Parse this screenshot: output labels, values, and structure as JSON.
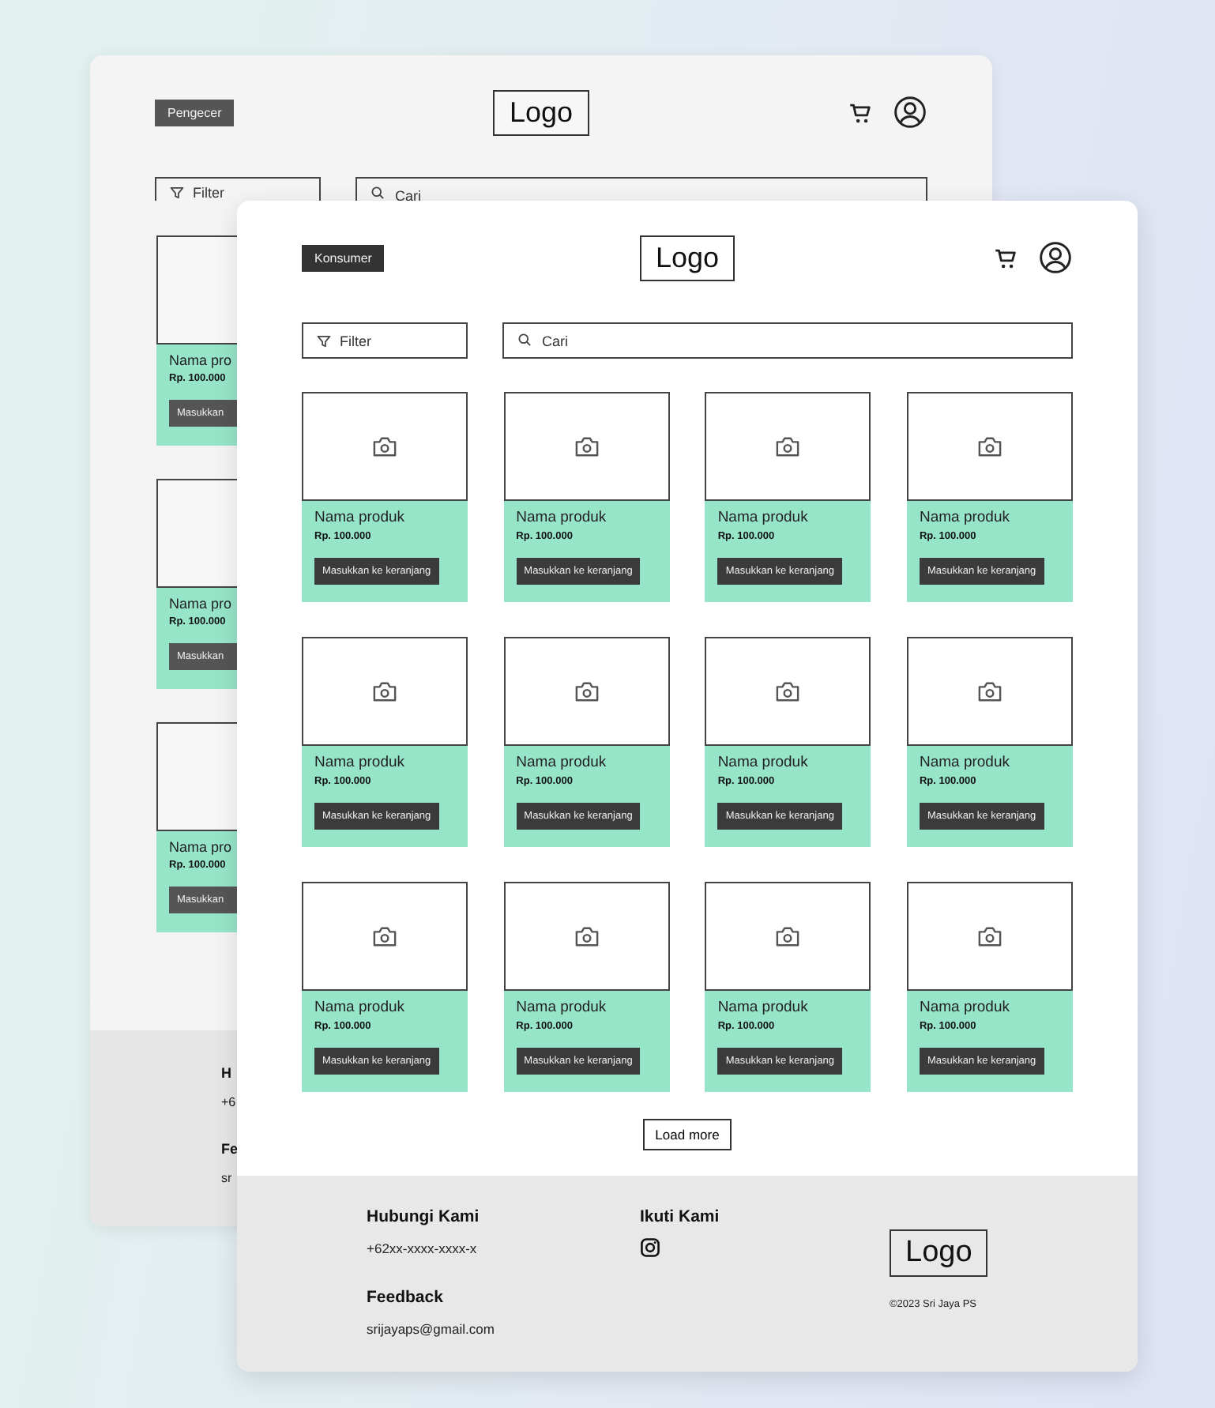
{
  "back_page": {
    "role_badge": "Pengecer",
    "logo": "Logo",
    "filter": {
      "label": "Filter"
    },
    "search": {
      "placeholder": "Cari"
    },
    "products": [
      {
        "name": "Nama pro",
        "price": "Rp. 100.000",
        "button": "Masukkan"
      },
      {
        "name": "Nama pro",
        "price": "Rp. 100.000",
        "button": "Masukkan"
      },
      {
        "name": "Nama pro",
        "price": "Rp. 100.000",
        "button": "Masukkan"
      }
    ],
    "footer": {
      "contact_heading": "H",
      "phone": "+6",
      "feedback_heading": "Fe",
      "email": "sr"
    }
  },
  "front_page": {
    "role_badge": "Konsumer",
    "logo": "Logo",
    "filter": {
      "label": "Filter"
    },
    "search": {
      "placeholder": "Cari"
    },
    "products": [
      {
        "name": "Nama produk",
        "price": "Rp. 100.000",
        "button": "Masukkan ke keranjang"
      },
      {
        "name": "Nama produk",
        "price": "Rp. 100.000",
        "button": "Masukkan ke keranjang"
      },
      {
        "name": "Nama produk",
        "price": "Rp. 100.000",
        "button": "Masukkan ke keranjang"
      },
      {
        "name": "Nama produk",
        "price": "Rp. 100.000",
        "button": "Masukkan ke keranjang"
      },
      {
        "name": "Nama produk",
        "price": "Rp. 100.000",
        "button": "Masukkan ke keranjang"
      },
      {
        "name": "Nama produk",
        "price": "Rp. 100.000",
        "button": "Masukkan ke keranjang"
      },
      {
        "name": "Nama produk",
        "price": "Rp. 100.000",
        "button": "Masukkan ke keranjang"
      },
      {
        "name": "Nama produk",
        "price": "Rp. 100.000",
        "button": "Masukkan ke keranjang"
      },
      {
        "name": "Nama produk",
        "price": "Rp. 100.000",
        "button": "Masukkan ke keranjang"
      },
      {
        "name": "Nama produk",
        "price": "Rp. 100.000",
        "button": "Masukkan ke keranjang"
      },
      {
        "name": "Nama produk",
        "price": "Rp. 100.000",
        "button": "Masukkan ke keranjang"
      },
      {
        "name": "Nama produk",
        "price": "Rp. 100.000",
        "button": "Masukkan ke keranjang"
      }
    ],
    "load_more": "Load more",
    "footer": {
      "contact_heading": "Hubungi Kami",
      "phone": "+62xx-xxxx-xxxx-x",
      "feedback_heading": "Feedback",
      "email": "srijayaps@gmail.com",
      "follow_heading": "Ikuti Kami",
      "logo": "Logo",
      "copyright": "©2023 Sri Jaya PS"
    }
  }
}
